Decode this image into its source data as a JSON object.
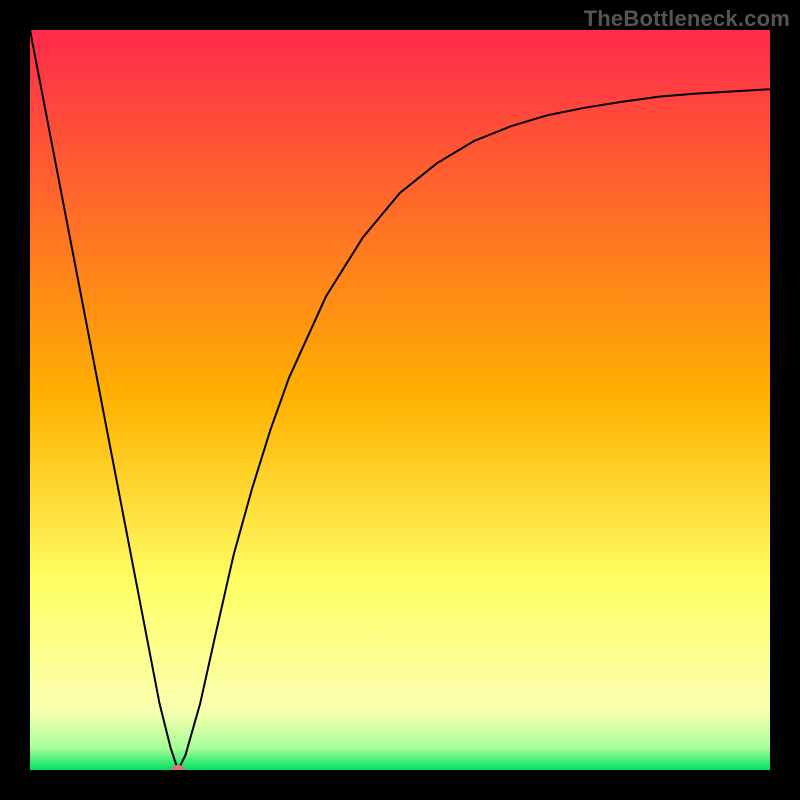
{
  "watermark": "TheBottleneck.com",
  "chart_data": {
    "type": "line",
    "title": "",
    "xlabel": "",
    "ylabel": "",
    "xlim": [
      0,
      1
    ],
    "ylim": [
      0,
      1
    ],
    "grid": false,
    "legend": false,
    "background_gradient": {
      "stops": [
        {
          "pos": 0.0,
          "color": "#ff2a4c"
        },
        {
          "pos": 0.5,
          "color": "#ffb200"
        },
        {
          "pos": 0.75,
          "color": "#ffff66"
        },
        {
          "pos": 0.92,
          "color": "#faffb0"
        },
        {
          "pos": 0.97,
          "color": "#a8ff9a"
        },
        {
          "pos": 1.0,
          "color": "#00e060"
        }
      ]
    },
    "series": [
      {
        "name": "bottleneck-v",
        "x": [
          0.0,
          0.025,
          0.05,
          0.075,
          0.1,
          0.125,
          0.15,
          0.175,
          0.19,
          0.2,
          0.21,
          0.23,
          0.25,
          0.275,
          0.3,
          0.325,
          0.35,
          0.4,
          0.45,
          0.5,
          0.55,
          0.6,
          0.65,
          0.7,
          0.75,
          0.8,
          0.85,
          0.9,
          0.95,
          1.0
        ],
        "y": [
          1.0,
          0.87,
          0.74,
          0.61,
          0.48,
          0.35,
          0.22,
          0.09,
          0.03,
          0.0,
          0.02,
          0.09,
          0.18,
          0.29,
          0.38,
          0.46,
          0.53,
          0.64,
          0.72,
          0.78,
          0.82,
          0.85,
          0.87,
          0.885,
          0.895,
          0.903,
          0.91,
          0.914,
          0.917,
          0.92
        ]
      }
    ],
    "marker": {
      "name": "vertex-point",
      "x": 0.2,
      "y": 0.0,
      "rx": 0.01,
      "ry": 0.007,
      "color": "#c97a7a"
    }
  }
}
